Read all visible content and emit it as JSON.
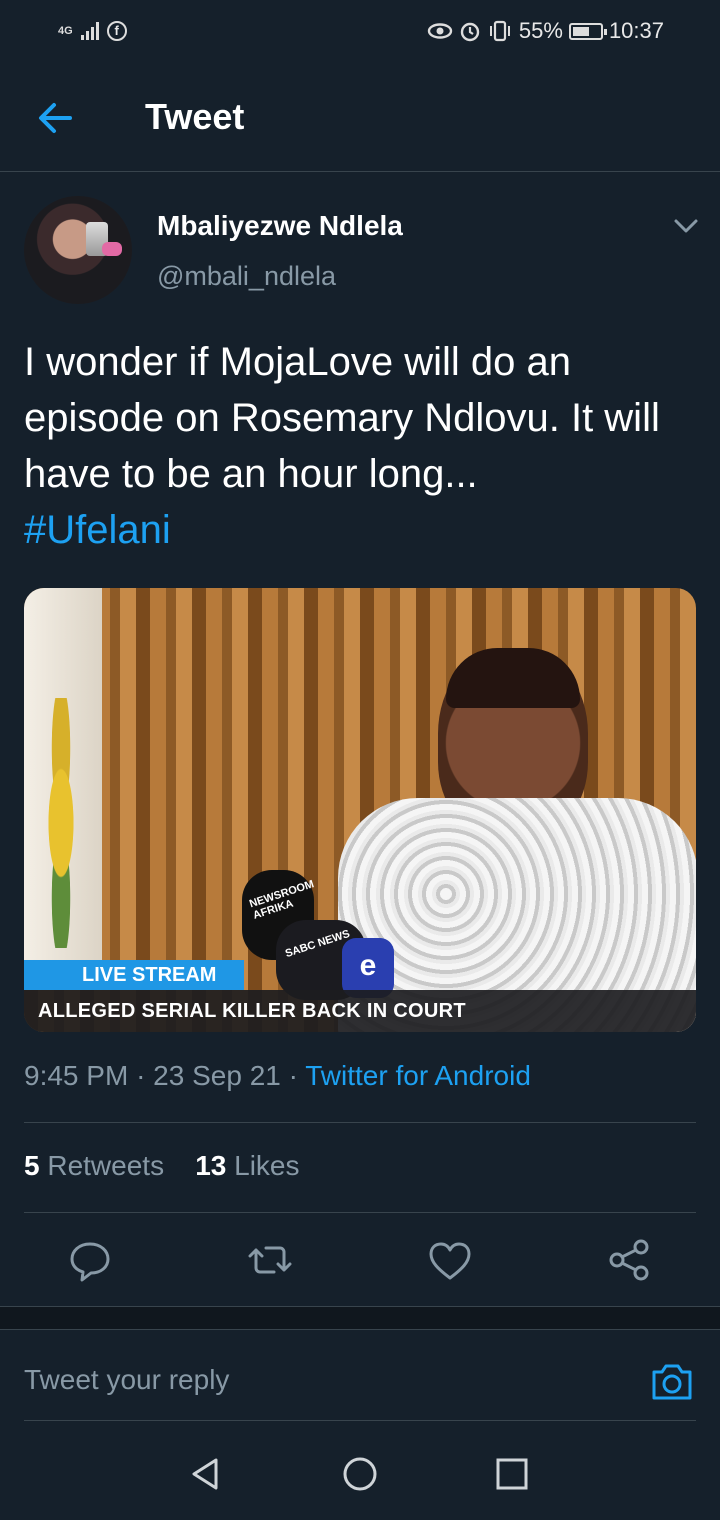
{
  "status_bar": {
    "network": "4G",
    "notification_icon": "facebook-icon",
    "battery": "55%",
    "time": "10:37"
  },
  "header": {
    "title": "Tweet",
    "back_icon": "back-arrow-icon"
  },
  "tweet": {
    "author_name": "Mbaliyezwe Ndlela",
    "author_handle": "@mbali_ndlela",
    "text": "I wonder if MojaLove will do an episode on Rosemary Ndlovu. It will have to be an hour long...",
    "hashtag": "#Ufelani",
    "media": {
      "live_label": "LIVE STREAM",
      "headline": "ALLEGED SERIAL KILLER BACK IN COURT",
      "mic_label_1": "NEWSROOM AFRIKA",
      "mic_label_2": "SABC NEWS",
      "mic_label_3": "e"
    },
    "time": "9:45 PM",
    "date": "23 Sep 21",
    "separator": "·",
    "source": "Twitter for Android",
    "retweets_count": "5",
    "retweets_label": "Retweets",
    "likes_count": "13",
    "likes_label": "Likes"
  },
  "actions": [
    "reply-icon",
    "retweet-icon",
    "like-icon",
    "share-icon"
  ],
  "reply_box": {
    "placeholder": "Tweet your reply",
    "camera_icon": "camera-icon"
  },
  "colors": {
    "background": "#15202b",
    "accent": "#1da1f2",
    "secondary_text": "#8899a6",
    "divider": "#38444d"
  }
}
